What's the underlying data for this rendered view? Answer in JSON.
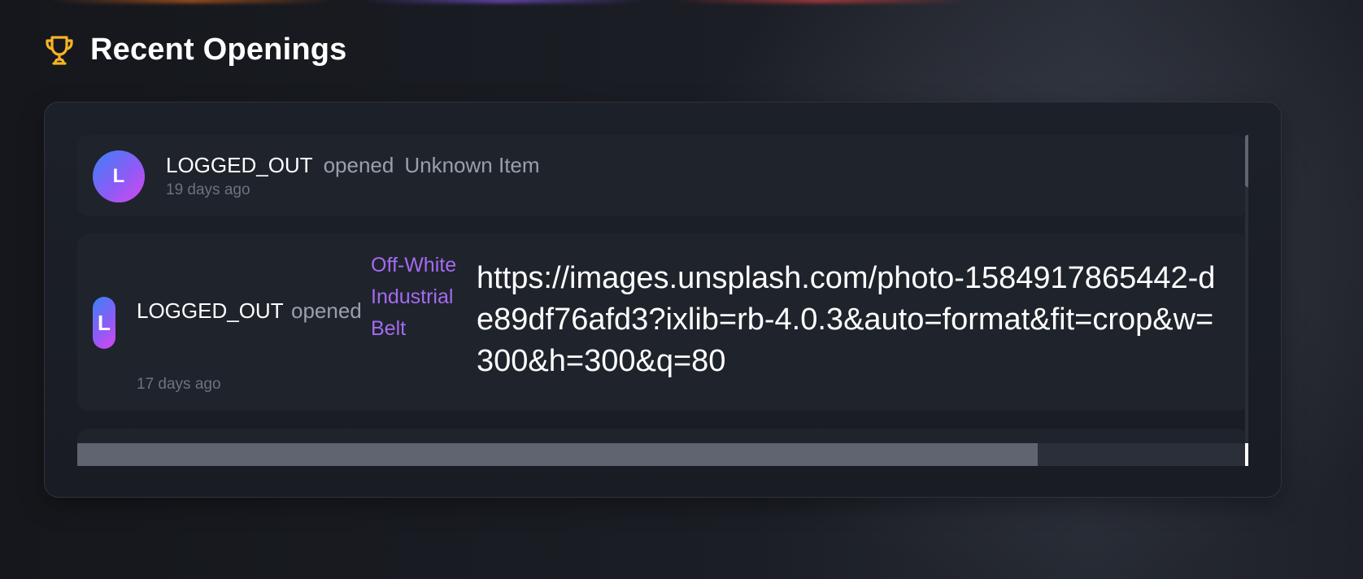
{
  "section": {
    "title": "Recent Openings",
    "icon": "trophy-icon",
    "icon_color": "#f5b324"
  },
  "openings": [
    {
      "avatar_letter": "L",
      "user": "LOGGED_OUT",
      "verb": "opened",
      "item": "Unknown Item",
      "item_color": "#9aa0aa",
      "time": "19 days ago"
    },
    {
      "avatar_letter": "L",
      "user": "LOGGED_OUT",
      "verb": "opened",
      "item": "Off-White Industrial Belt",
      "item_color": "#a36bf0",
      "image_url": "https://images.unsplash.com/photo-1584917865442-de89df76afd3?ixlib=rb-4.0.3&auto=format&fit=crop&w=300&h=300&q=80",
      "time": "17 days ago"
    }
  ],
  "scrollbars": {
    "horizontal_fraction_visible": 0.82,
    "vertical_fraction_visible": 0.17
  },
  "colors": {
    "accent_purple": "#8b5cf6",
    "accent_orange": "#f97316",
    "accent_red": "#ef4444"
  }
}
